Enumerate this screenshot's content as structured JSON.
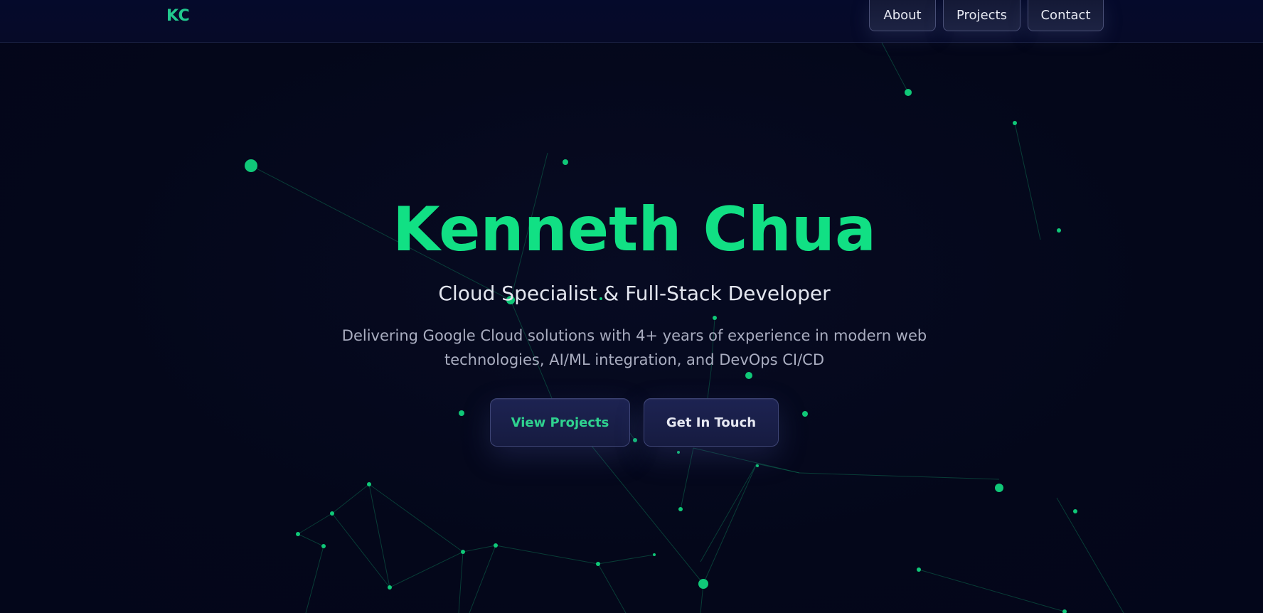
{
  "nav": {
    "logo": "KC",
    "links": [
      "About",
      "Projects",
      "Contact"
    ]
  },
  "hero": {
    "title": "Kenneth Chua",
    "subtitle": "Cloud Specialist & Full-Stack Developer",
    "description": "Delivering Google Cloud solutions with 4+ years of experience in modern web technologies, AI/ML integration, and DevOps CI/CD",
    "primary_button": "View Projects",
    "secondary_button": "Get In Touch"
  },
  "colors": {
    "background": "#04071a",
    "accent": "#11e084",
    "network_node": "#10c878",
    "network_line": "#0c6a4f"
  }
}
